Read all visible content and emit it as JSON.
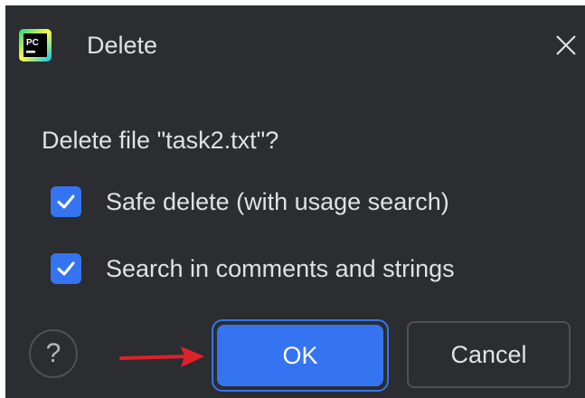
{
  "window": {
    "title": "Delete",
    "app_icon_text": "PC"
  },
  "dialog": {
    "message": "Delete file \"task2.txt\"?",
    "options": [
      {
        "label": "Safe delete (with usage search)",
        "checked": true
      },
      {
        "label": "Search in comments and strings",
        "checked": true
      }
    ],
    "help_label": "?",
    "ok_label": "OK",
    "cancel_label": "Cancel"
  },
  "icons": {
    "close": "close-icon",
    "checkbox": "check-icon",
    "arrow": "red-arrow-icon"
  },
  "colors": {
    "background": "#2b2d30",
    "accent": "#3574f0",
    "text": "#dfe1e5",
    "arrow": "#e0212b"
  }
}
